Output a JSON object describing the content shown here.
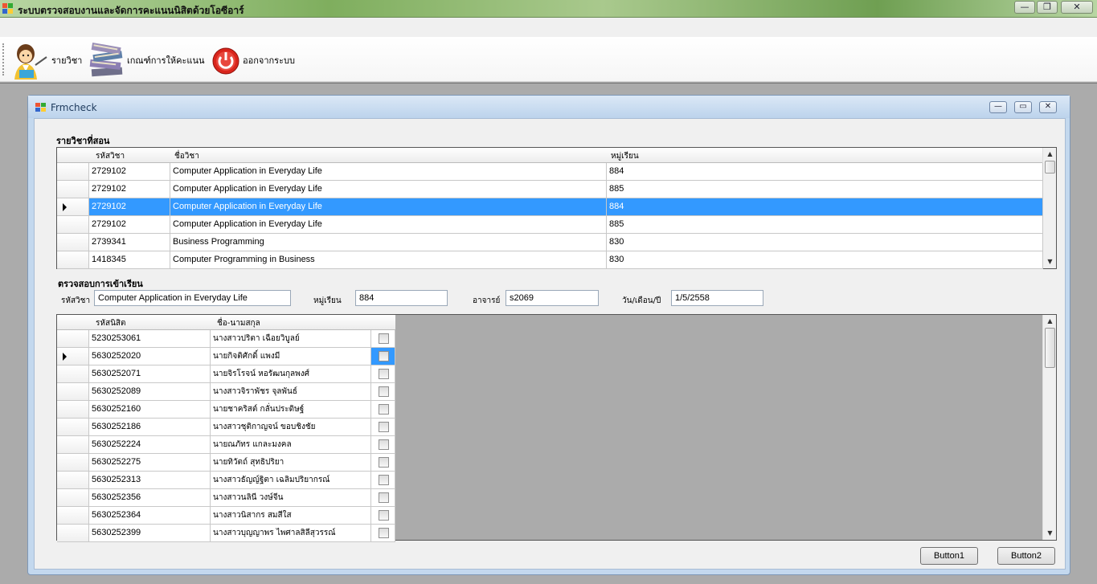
{
  "app": {
    "title": "ระบบตรวจสอบงานและจัดการคะแนนนิสิตด้วยโอซีอาร์",
    "minimize_glyph": "—",
    "restore_glyph": "❐",
    "close_glyph": "✕"
  },
  "toolbar": {
    "items": [
      {
        "label": "รายวิชา",
        "icon": "teacher-icon"
      },
      {
        "label": "เกณฑ์การให้คะแนน",
        "icon": "books-icon"
      },
      {
        "label": "ออกจากระบบ",
        "icon": "power-icon"
      }
    ]
  },
  "child": {
    "title": "Frmcheck",
    "minimize_glyph": "—",
    "restore_glyph": "▭",
    "close_glyph": "✕"
  },
  "courses": {
    "section_label": "รายวิชาที่สอน",
    "columns": [
      "รหัสวิชา",
      "ชื่อวิชา",
      "หมู่เรียน"
    ],
    "rows": [
      {
        "code": "2729102",
        "name": "Computer Application in Everyday Life",
        "section": "884"
      },
      {
        "code": "2729102",
        "name": "Computer Application in Everyday Life",
        "section": "885"
      },
      {
        "code": "2729102",
        "name": "Computer Application in Everyday Life",
        "section": "884"
      },
      {
        "code": "2729102",
        "name": "Computer Application in Everyday Life",
        "section": "885"
      },
      {
        "code": "2739341",
        "name": "Business Programming",
        "section": "830"
      },
      {
        "code": "1418345",
        "name": "Computer Programming in Business",
        "section": "830"
      }
    ],
    "selected_index": 2
  },
  "attendance": {
    "section_label": "ตรวจสอบการเข้าเรียน",
    "course_label": "รหัสวิชา",
    "course_value": "Computer Application in Everyday Life",
    "section_field_label": "หมู่เรียน",
    "section_value": "884",
    "teacher_label": "อาจารย์",
    "teacher_value": "s2069",
    "date_label": "วัน/เดือน/ปี",
    "date_value": "1/5/2558"
  },
  "students": {
    "columns": [
      "รหัสนิสิต",
      "ชื่อ-นามสกุล"
    ],
    "rows": [
      {
        "id": "5230253061",
        "name": "นางสาวปริตา เฉือยวิบูลย์"
      },
      {
        "id": "5630252020",
        "name": "นายกิจติศักดิ์ แพงมี"
      },
      {
        "id": "5630252071",
        "name": "นายจิรโรจน์ หอรัฒนกุลพงศ์"
      },
      {
        "id": "5630252089",
        "name": "นางสาวจิราพัชร จุลพันธ์"
      },
      {
        "id": "5630252160",
        "name": "นายชาคริสต์ กลั่นประดิษฐ์"
      },
      {
        "id": "5630252186",
        "name": "นางสาวชุติกาญจน์ ขอบชิงชัย"
      },
      {
        "id": "5630252224",
        "name": "นายณภัทร แกละมงคล"
      },
      {
        "id": "5630252275",
        "name": "นายทิวัตถ์ สุทธิปริยา"
      },
      {
        "id": "5630252313",
        "name": "นางสาวธัญญ์ฐิตา เฉลิมปริยากรณ์"
      },
      {
        "id": "5630252356",
        "name": "นางสาวนลินี วงษ์จีน"
      },
      {
        "id": "5630252364",
        "name": "นางสาวนิสากร สมสีใส"
      },
      {
        "id": "5630252399",
        "name": "นางสาวบุญญาพร ไพศาลสิลีสุวรรณ์"
      }
    ],
    "current_index": 1
  },
  "buttons": {
    "button1": "Button1",
    "button2": "Button2"
  },
  "colors": {
    "selection": "#3399ff",
    "title_green": "#7fae5e",
    "child_frame": "#c3d8ee",
    "power_red": "#d9251c"
  }
}
